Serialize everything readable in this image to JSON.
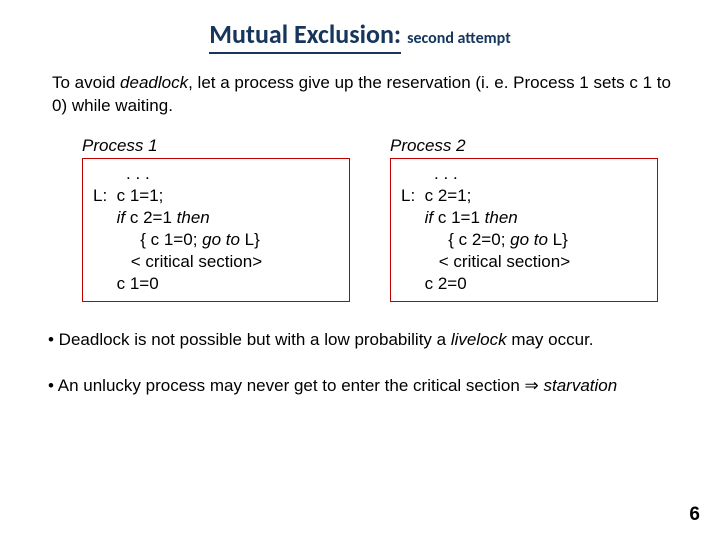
{
  "title": {
    "main": "Mutual Exclusion:",
    "sub": "second attempt"
  },
  "intro": {
    "pre": "To avoid ",
    "em": "deadlock",
    "post": ", let a process give up the reservation (i. e. Process 1 sets c 1 to 0) while waiting."
  },
  "process1": {
    "heading": "Process 1",
    "l1": "       . . .",
    "l2a": "L:  c 1=1;",
    "l3_pre": "     ",
    "l3_if": "if",
    "l3_mid": " c 2=1 ",
    "l3_then": "then",
    "l4_pre": "          { c 1=0; ",
    "l4_goto": "go to",
    "l4_post": " L}",
    "l5": "        < critical section>",
    "l6": "     c 1=0"
  },
  "process2": {
    "heading": "Process 2",
    "l1": "       . . .",
    "l2a": "L:  c 2=1;",
    "l3_pre": "     ",
    "l3_if": "if",
    "l3_mid": " c 1=1 ",
    "l3_then": "then",
    "l4_pre": "          { c 2=0; ",
    "l4_goto": "go to",
    "l4_post": " L}",
    "l5": "        < critical section>",
    "l6": "     c 2=0"
  },
  "bullet1": {
    "pre": "• Deadlock is not possible but with a low probability a ",
    "em": "livelock",
    "post": " may occur."
  },
  "bullet2": {
    "pre": "• An unlucky process may never get to enter the critical section ",
    "arrow": "⇒",
    "em": " starvation"
  },
  "page": "6"
}
